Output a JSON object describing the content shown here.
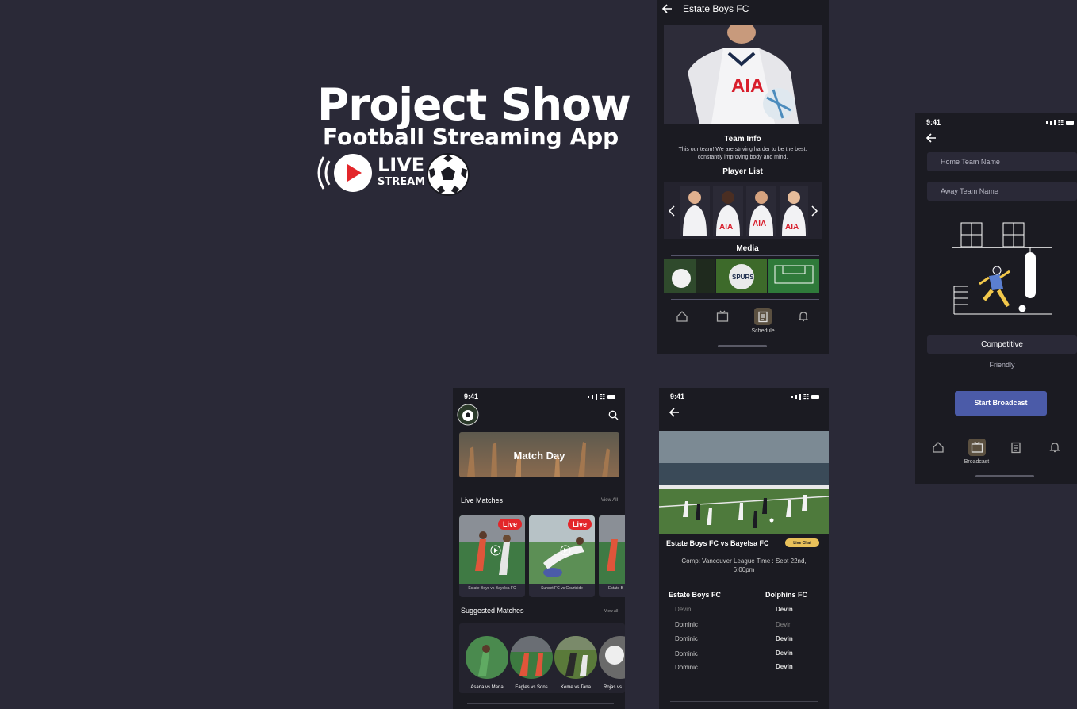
{
  "hero": {
    "title": "Project Show",
    "subtitle": "Football Streaming App",
    "live_line1": "LIVE",
    "live_line2": "STREAM"
  },
  "team_screen": {
    "title": "Estate Boys FC",
    "team_info_heading": "Team Info",
    "team_info_text": "This our team! We are striving harder to be the best, constantly improving body and mind.",
    "player_list_heading": "Player List",
    "media_heading": "Media",
    "nav": [
      {
        "icon": "home-icon",
        "label": ""
      },
      {
        "icon": "tv-icon",
        "label": ""
      },
      {
        "icon": "clipboard-icon",
        "label": "Schedule"
      },
      {
        "icon": "bell-icon",
        "label": ""
      }
    ]
  },
  "broadcast_screen": {
    "time": "9:41",
    "home_placeholder": "Home Team Name",
    "away_placeholder": "Away Team Name",
    "option_competitive": "Competitive",
    "option_friendly": "Friendly",
    "start_button": "Start Broadcast",
    "nav": [
      {
        "icon": "home-icon",
        "label": ""
      },
      {
        "icon": "tv-icon",
        "label": "Broadcast"
      },
      {
        "icon": "clipboard-icon",
        "label": ""
      },
      {
        "icon": "bell-icon",
        "label": ""
      }
    ]
  },
  "home_screen": {
    "time": "9:41",
    "banner": "Match Day",
    "live_heading": "Live Matches",
    "live_view_all": "View All",
    "live_matches": [
      {
        "caption": "Estate Boys vs Bayelsa FC",
        "tag": "Live"
      },
      {
        "caption": "Sunset FC vs Courtside",
        "tag": "Live"
      },
      {
        "caption": "Estate B",
        "tag": ""
      }
    ],
    "suggested_heading": "Suggested Matches",
    "suggested_view_all": "View All",
    "suggested": [
      {
        "caption": "Asana vs Mana"
      },
      {
        "caption": "Eagles vs Sons"
      },
      {
        "caption": "Keme vs Tana"
      },
      {
        "caption": "Rojas vs"
      }
    ]
  },
  "match_screen": {
    "time": "9:41",
    "match_title": "Estate Boys FC vs Bayelsa FC",
    "live_chat": "Live Chat",
    "comp_info": "Comp:  Vancouver League Time : Sept 22nd, 6:00pm",
    "home_team": "Estate Boys FC",
    "away_team": "Dolphins FC",
    "home_players": [
      "Devin",
      "Dominic",
      "Dominic",
      "Dominic",
      "Dominic"
    ],
    "away_players": [
      "Devin",
      "Devin",
      "Devin",
      "Devin",
      "Devin"
    ]
  },
  "colors": {
    "bg": "#2a2937",
    "phone": "#1b1b22",
    "accent": "#4b5ba8",
    "live": "#e3262a",
    "chat": "#e9c15a"
  }
}
